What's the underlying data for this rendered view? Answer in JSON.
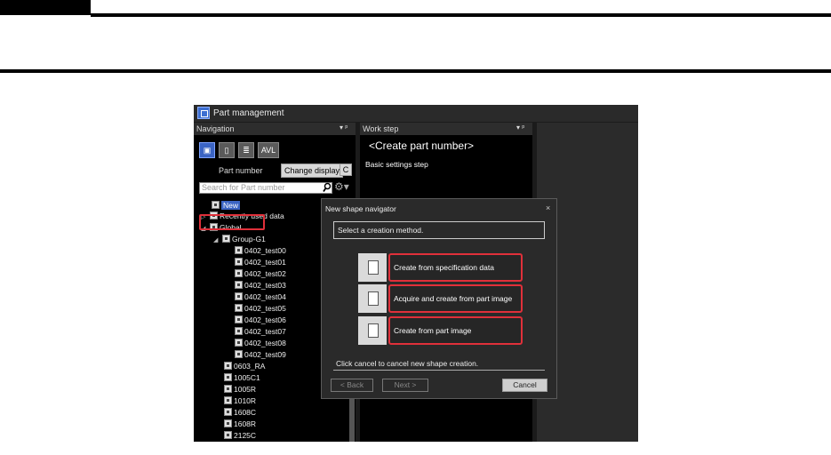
{
  "app": {
    "title": "Part management"
  },
  "navigation": {
    "header": "Navigation",
    "pin_glyph": "▾ ᵖ",
    "toolbar": [
      {
        "icon": "part-number-icon",
        "label": ""
      },
      {
        "icon": "part-shape-icon",
        "label": ""
      },
      {
        "icon": "part-list-icon",
        "label": ""
      },
      {
        "icon": "avl-icon",
        "label": "AVL"
      }
    ],
    "part_number_label": "Part number",
    "change_display_label": "Change display",
    "refresh_glyph": "C",
    "search_placeholder": "Search for Part number",
    "tree": {
      "new": "New",
      "recently_used": "Recently used data",
      "global": "Global",
      "group": "Group-G1",
      "group_items": [
        "0402_test00",
        "0402_test01",
        "0402_test02",
        "0402_test03",
        "0402_test04",
        "0402_test05",
        "0402_test06",
        "0402_test07",
        "0402_test08",
        "0402_test09"
      ],
      "items": [
        "0603_RA",
        "1005C1",
        "1005R",
        "1010R",
        "1608C",
        "1608R",
        "2125C"
      ]
    }
  },
  "work_step": {
    "header": "Work step",
    "pin_glyph": "▾ ᵖ",
    "title": "<Create part number>",
    "subtitle": "Basic settings step"
  },
  "dialog": {
    "title": "New shape navigator",
    "close_glyph": "×",
    "prompt": "Select a creation method.",
    "options": [
      {
        "label": "Create from specification data",
        "icon": "specification-data-icon"
      },
      {
        "label": "Acquire and create from part image",
        "icon": "camera-acquire-icon"
      },
      {
        "label": "Create from part image",
        "icon": "part-image-icon"
      }
    ],
    "hint": "Click cancel to cancel new shape creation.",
    "back_label": "< Back",
    "next_label": "Next >",
    "cancel_label": "Cancel"
  },
  "colors": {
    "highlight": "#e0303a",
    "accent": "#3b64c4"
  }
}
